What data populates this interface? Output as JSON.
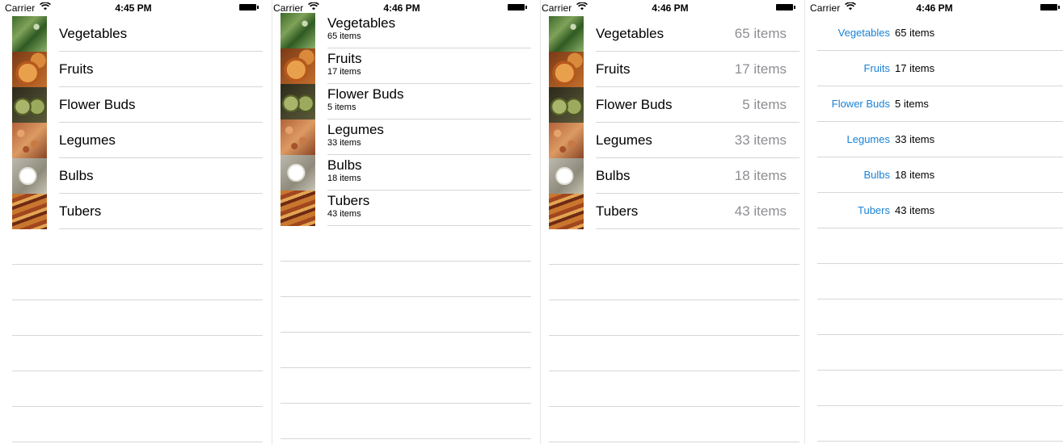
{
  "status_bars": [
    {
      "carrier": "Carrier",
      "time": "4:45 PM"
    },
    {
      "carrier": "Carrier",
      "time": "4:46 PM"
    },
    {
      "carrier": "Carrier",
      "time": "4:46 PM"
    },
    {
      "carrier": "Carrier",
      "time": "4:46 PM"
    }
  ],
  "categories": [
    {
      "name": "Vegetables",
      "count": "65 items",
      "thumb_icon": "vegetables-thumbnail"
    },
    {
      "name": "Fruits",
      "count": "17 items",
      "thumb_icon": "fruits-thumbnail"
    },
    {
      "name": "Flower Buds",
      "count": "5 items",
      "thumb_icon": "flower-buds-thumbnail"
    },
    {
      "name": "Legumes",
      "count": "33 items",
      "thumb_icon": "legumes-thumbnail"
    },
    {
      "name": "Bulbs",
      "count": "18 items",
      "thumb_icon": "bulbs-thumbnail"
    },
    {
      "name": "Tubers",
      "count": "43 items",
      "thumb_icon": "tubers-thumbnail"
    }
  ],
  "colors": {
    "accent_label": "#1a82d6",
    "detail_gray": "#8e8e93",
    "separator": "#d6d6d6"
  }
}
